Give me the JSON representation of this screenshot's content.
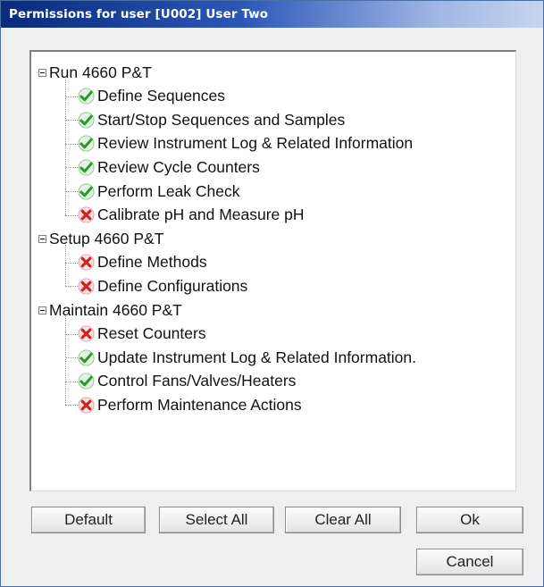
{
  "window": {
    "title": "Permissions for user  [U002] User Two"
  },
  "tree": {
    "groups": [
      {
        "label": "Run 4660 P&T",
        "items": [
          {
            "label": "Define Sequences",
            "status": "allowed"
          },
          {
            "label": "Start/Stop Sequences and Samples",
            "status": "allowed"
          },
          {
            "label": "Review Instrument Log & Related Information",
            "status": "allowed"
          },
          {
            "label": "Review Cycle Counters",
            "status": "allowed"
          },
          {
            "label": "Perform Leak Check",
            "status": "allowed"
          },
          {
            "label": "Calibrate pH and Measure pH",
            "status": "denied"
          }
        ]
      },
      {
        "label": "Setup 4660 P&T",
        "items": [
          {
            "label": "Define Methods",
            "status": "denied"
          },
          {
            "label": "Define Configurations",
            "status": "denied"
          }
        ]
      },
      {
        "label": "Maintain 4660 P&T",
        "items": [
          {
            "label": "Reset Counters",
            "status": "denied"
          },
          {
            "label": "Update Instrument Log & Related Information.",
            "status": "allowed"
          },
          {
            "label": "Control Fans/Valves/Heaters",
            "status": "allowed"
          },
          {
            "label": "Perform Maintenance Actions",
            "status": "denied"
          }
        ]
      }
    ]
  },
  "buttons": {
    "default_label": "Default",
    "select_all_label": "Select All",
    "clear_all_label": "Clear All",
    "ok_label": "Ok",
    "cancel_label": "Cancel"
  },
  "colors": {
    "allowed": "#2e9a2e",
    "denied": "#d42020",
    "titlebar": "#0a2a7a"
  },
  "icons": {
    "allowed": "check-icon",
    "denied": "cross-icon",
    "group": "collapse-icon"
  }
}
